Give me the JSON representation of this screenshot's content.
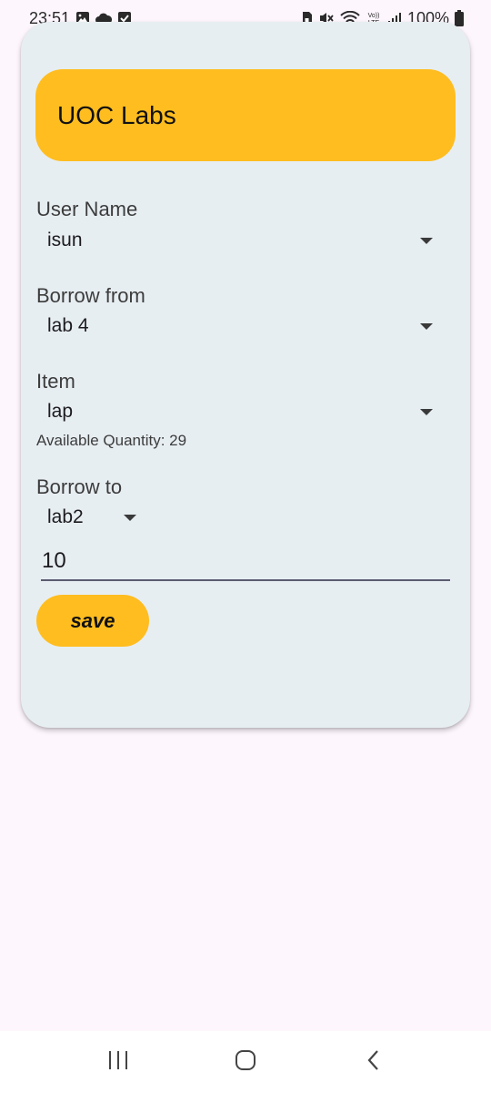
{
  "status_bar": {
    "time": "23:51",
    "battery": "100%",
    "left_icons": [
      "image-icon",
      "cloud-icon",
      "checkbox-icon"
    ],
    "right_icons": [
      "sim-lock-icon",
      "mute-icon",
      "wifi-icon",
      "volte-icon",
      "signal-icon",
      "battery-icon"
    ],
    "volte_label": "VoLTE"
  },
  "header": {
    "title": "UOC Labs"
  },
  "form": {
    "user_name": {
      "label": "User Name",
      "value": "isun"
    },
    "borrow_from": {
      "label": "Borrow from",
      "value": "lab 4"
    },
    "item": {
      "label": "Item",
      "value": "lap",
      "hint": "Available Quantity: 29"
    },
    "borrow_to": {
      "label": "Borrow to",
      "value": "lab2"
    },
    "quantity": {
      "value": "10"
    },
    "save_label": "save"
  },
  "colors": {
    "accent": "#ffbd1f",
    "card": "#e7eef2",
    "background": "#fdf6fd"
  },
  "nav_bar": {
    "icons": [
      "recents-icon",
      "home-icon",
      "back-icon"
    ]
  }
}
